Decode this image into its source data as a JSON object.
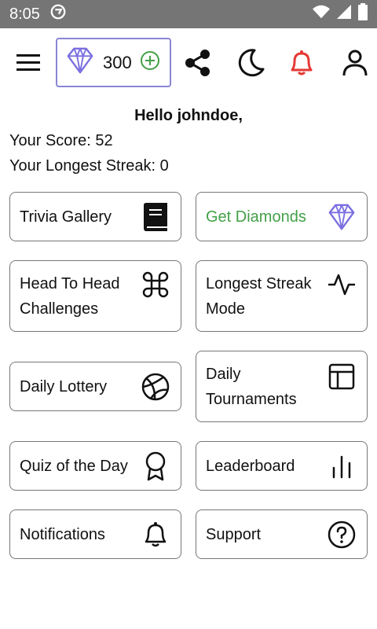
{
  "status_bar": {
    "time": "8:05"
  },
  "header": {
    "menu_icon": "hamburger-icon",
    "diamonds": {
      "count": "300",
      "add_icon": "plus-circle-icon"
    },
    "share_icon": "share-icon",
    "theme_icon": "moon-icon",
    "notifications_icon": "bell-icon",
    "profile_icon": "person-icon"
  },
  "user": {
    "greeting": "Hello johndoe,",
    "score": "Your Score: 52",
    "streak": "Your Longest Streak: 0"
  },
  "tiles": [
    {
      "label": "Trivia Gallery",
      "icon": "book-icon"
    },
    {
      "label": "Get Diamonds",
      "icon": "diamond-icon"
    },
    {
      "label": "Head To Head Challenges",
      "icon": "command-icon"
    },
    {
      "label": "Longest Streak Mode",
      "icon": "activity-icon"
    },
    {
      "label": "Daily Lottery",
      "icon": "basketball-icon"
    },
    {
      "label": "Daily Tournaments",
      "icon": "layout-icon"
    },
    {
      "label": "Quiz of the Day",
      "icon": "award-icon"
    },
    {
      "label": "Leaderboard",
      "icon": "bar-chart-icon"
    },
    {
      "label": "Notifications",
      "icon": "bell-icon"
    },
    {
      "label": "Support",
      "icon": "help-circle-icon"
    }
  ],
  "colors": {
    "accent_purple": "#7b6fe0",
    "diamond_border": "#8a86d6",
    "green": "#43a047",
    "notification_red": "#e53935",
    "status_bar": "#757575"
  }
}
